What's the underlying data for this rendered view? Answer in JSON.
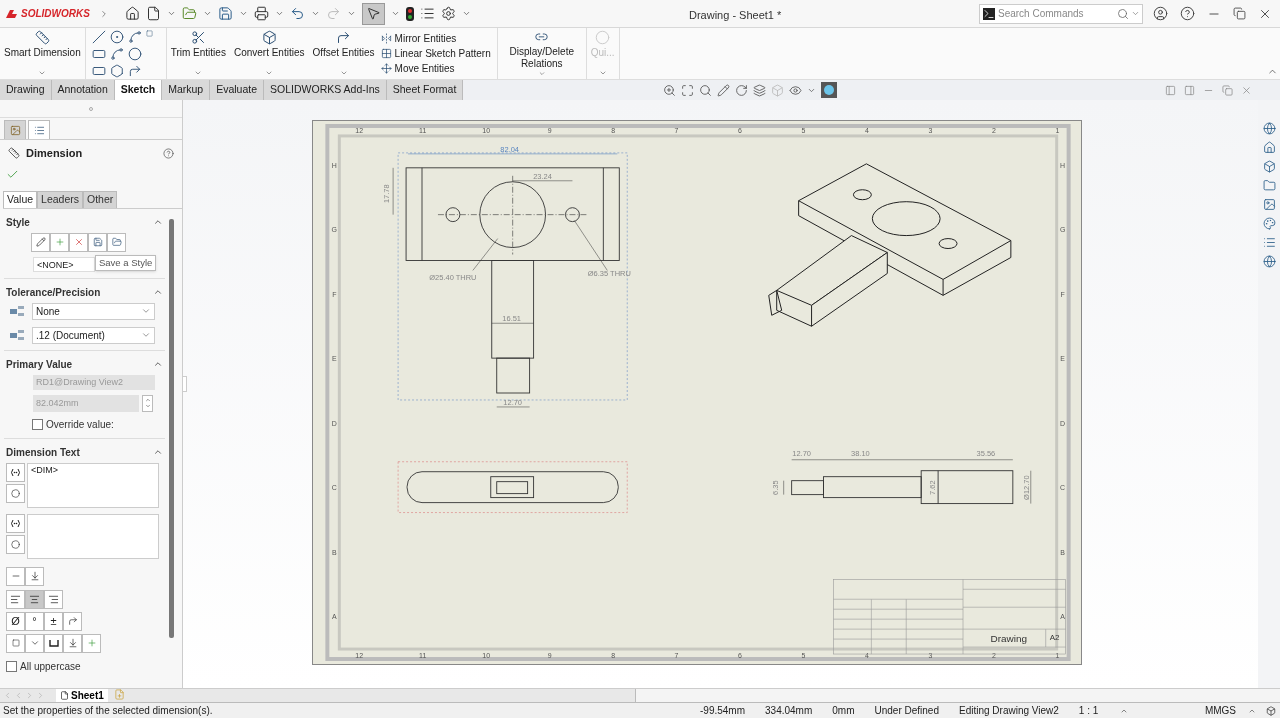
{
  "app": {
    "logo": "SOLIDWORKS",
    "title": "Drawing - Sheet1 *"
  },
  "search": {
    "placeholder": "Search Commands"
  },
  "commands": [
    {
      "kind": "large",
      "label": "Smart Dimension",
      "disabled": false
    },
    {
      "kind": "tools"
    },
    {
      "kind": "large",
      "label": "Trim Entities",
      "disabled": false
    },
    {
      "kind": "large",
      "label": "Convert Entities",
      "disabled": false
    },
    {
      "kind": "large",
      "label": "Offset Entities",
      "disabled": false
    },
    {
      "kind": "stack",
      "items": [
        "Mirror Entities",
        "Linear Sketch Pattern",
        "Move Entities"
      ]
    },
    {
      "kind": "large",
      "label": "Display/Delete Relations",
      "disabled": false
    },
    {
      "kind": "large",
      "label": "Qui...",
      "disabled": true
    }
  ],
  "tabs": [
    {
      "label": "Drawing",
      "selected": false
    },
    {
      "label": "Annotation",
      "selected": false
    },
    {
      "label": "Sketch",
      "selected": true
    },
    {
      "label": "Markup",
      "selected": false
    },
    {
      "label": "Evaluate",
      "selected": false
    },
    {
      "label": "SOLIDWORKS Add-Ins",
      "selected": false
    },
    {
      "label": "Sheet Format",
      "selected": false
    }
  ],
  "panel": {
    "manager_tabs": [
      {
        "selected": false
      },
      {
        "selected": true
      }
    ],
    "title": "Dimension",
    "tabs": [
      {
        "label": "Value",
        "selected": true
      },
      {
        "label": "Leaders",
        "selected": false
      },
      {
        "label": "Other",
        "selected": false
      }
    ],
    "style": {
      "title": "Style",
      "expanded": true,
      "value": "<NONE>",
      "tooltip": "Save a Style"
    },
    "tolerance": {
      "title": "Tolerance/Precision",
      "expanded": true,
      "tolerance": "None",
      "precision": ".12 (Document)"
    },
    "primary": {
      "title": "Primary Value",
      "expanded": true,
      "reference": "RD1@Drawing View2",
      "value": "82.042mm",
      "override": {
        "label": "Override value:",
        "checked": false
      }
    },
    "dim_text": {
      "title": "Dimension Text",
      "expanded": true,
      "text": "<DIM>"
    },
    "alignment": [
      {
        "selected": false
      },
      {
        "selected": true
      },
      {
        "selected": false
      }
    ],
    "symbols": [
      "Ø",
      "°",
      "±"
    ],
    "uppercase": {
      "label": "All uppercase",
      "checked": false
    }
  },
  "sheet": {
    "top_columns": [
      "12",
      "11",
      "10",
      "9",
      "8",
      "7",
      "6",
      "5",
      "4",
      "3",
      "2",
      "1"
    ],
    "bottom_columns": [
      "12",
      "11",
      "10",
      "9",
      "8",
      "7",
      "6",
      "5",
      "4",
      "3",
      "2",
      "1"
    ],
    "left_rows": [
      "H",
      "G",
      "F",
      "E",
      "D",
      "C",
      "B",
      "A"
    ],
    "right_rows": [
      "H",
      "G",
      "F",
      "E",
      "D",
      "C",
      "B",
      "A"
    ],
    "front_dims": [
      "82.04",
      "23.24",
      "17.78",
      "Ø25.40 THRU",
      "Ø6.35 THRU",
      "16.51",
      "12.70"
    ],
    "side_dims": [
      "12.70",
      "38.10",
      "35.56",
      "6.35",
      "7.62",
      "Ø12.70"
    ],
    "title_block": {
      "title": "Drawing",
      "size": "A2"
    }
  },
  "sheet_tabs": [
    {
      "label": "Sheet1",
      "selected": true
    }
  ],
  "status": {
    "message": "Set the properties of the selected dimension(s).",
    "fields": [
      "-99.54mm",
      "334.04mm",
      "0mm",
      "Under Defined",
      "Editing Drawing View2",
      "1 : 1"
    ],
    "units": "MMGS"
  }
}
